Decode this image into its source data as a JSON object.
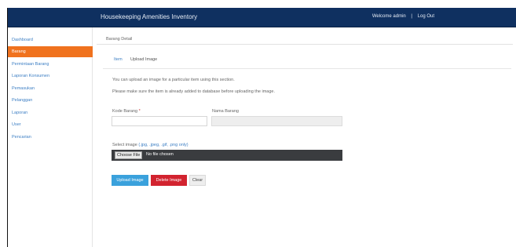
{
  "app": {
    "title": "Housekeeping Amenities Inventory",
    "welcome": "Welcome admin",
    "separator": "|",
    "logout": "Log Out"
  },
  "sidebar": {
    "items": [
      {
        "label": "Dashboard",
        "active": false
      },
      {
        "label": "Barang",
        "active": true
      },
      {
        "label": "Permintaan Barang",
        "active": false
      },
      {
        "label": "Laporan Konsumen",
        "active": false
      },
      {
        "label": "Pemasukan",
        "active": false
      },
      {
        "label": "Pelanggan",
        "active": false
      },
      {
        "label": "Laporan",
        "active": false
      },
      {
        "label": "User",
        "active": false
      },
      {
        "label": "Pencarian",
        "active": false
      }
    ]
  },
  "main": {
    "breadcrumb": "Barang Detail",
    "tabs": [
      {
        "label": "Item",
        "active": false
      },
      {
        "label": "Upload Image",
        "active": true
      }
    ],
    "info_line_1": "You can upload an image for a particular item using this section.",
    "info_line_2": "Please make sure the item is already added to database before uploading the image.",
    "kode_label": "Kode Barang",
    "kode_required": "*",
    "kode_value": "",
    "nama_label": "Nama Barang",
    "nama_value": "",
    "file_label": "Select image",
    "file_types": "(.jpg, .jpeg, .gif, .png only)",
    "file_button": "Choose File",
    "file_status": "No file chosen",
    "upload_button": "Upload Image",
    "delete_button": "Delete Image",
    "clear_button": "Clear"
  },
  "colors": {
    "navbar": "#0f3060",
    "sidebar_active": "#f0721e",
    "upload_button": "#3aa1dc",
    "delete_button": "#d2232f"
  }
}
